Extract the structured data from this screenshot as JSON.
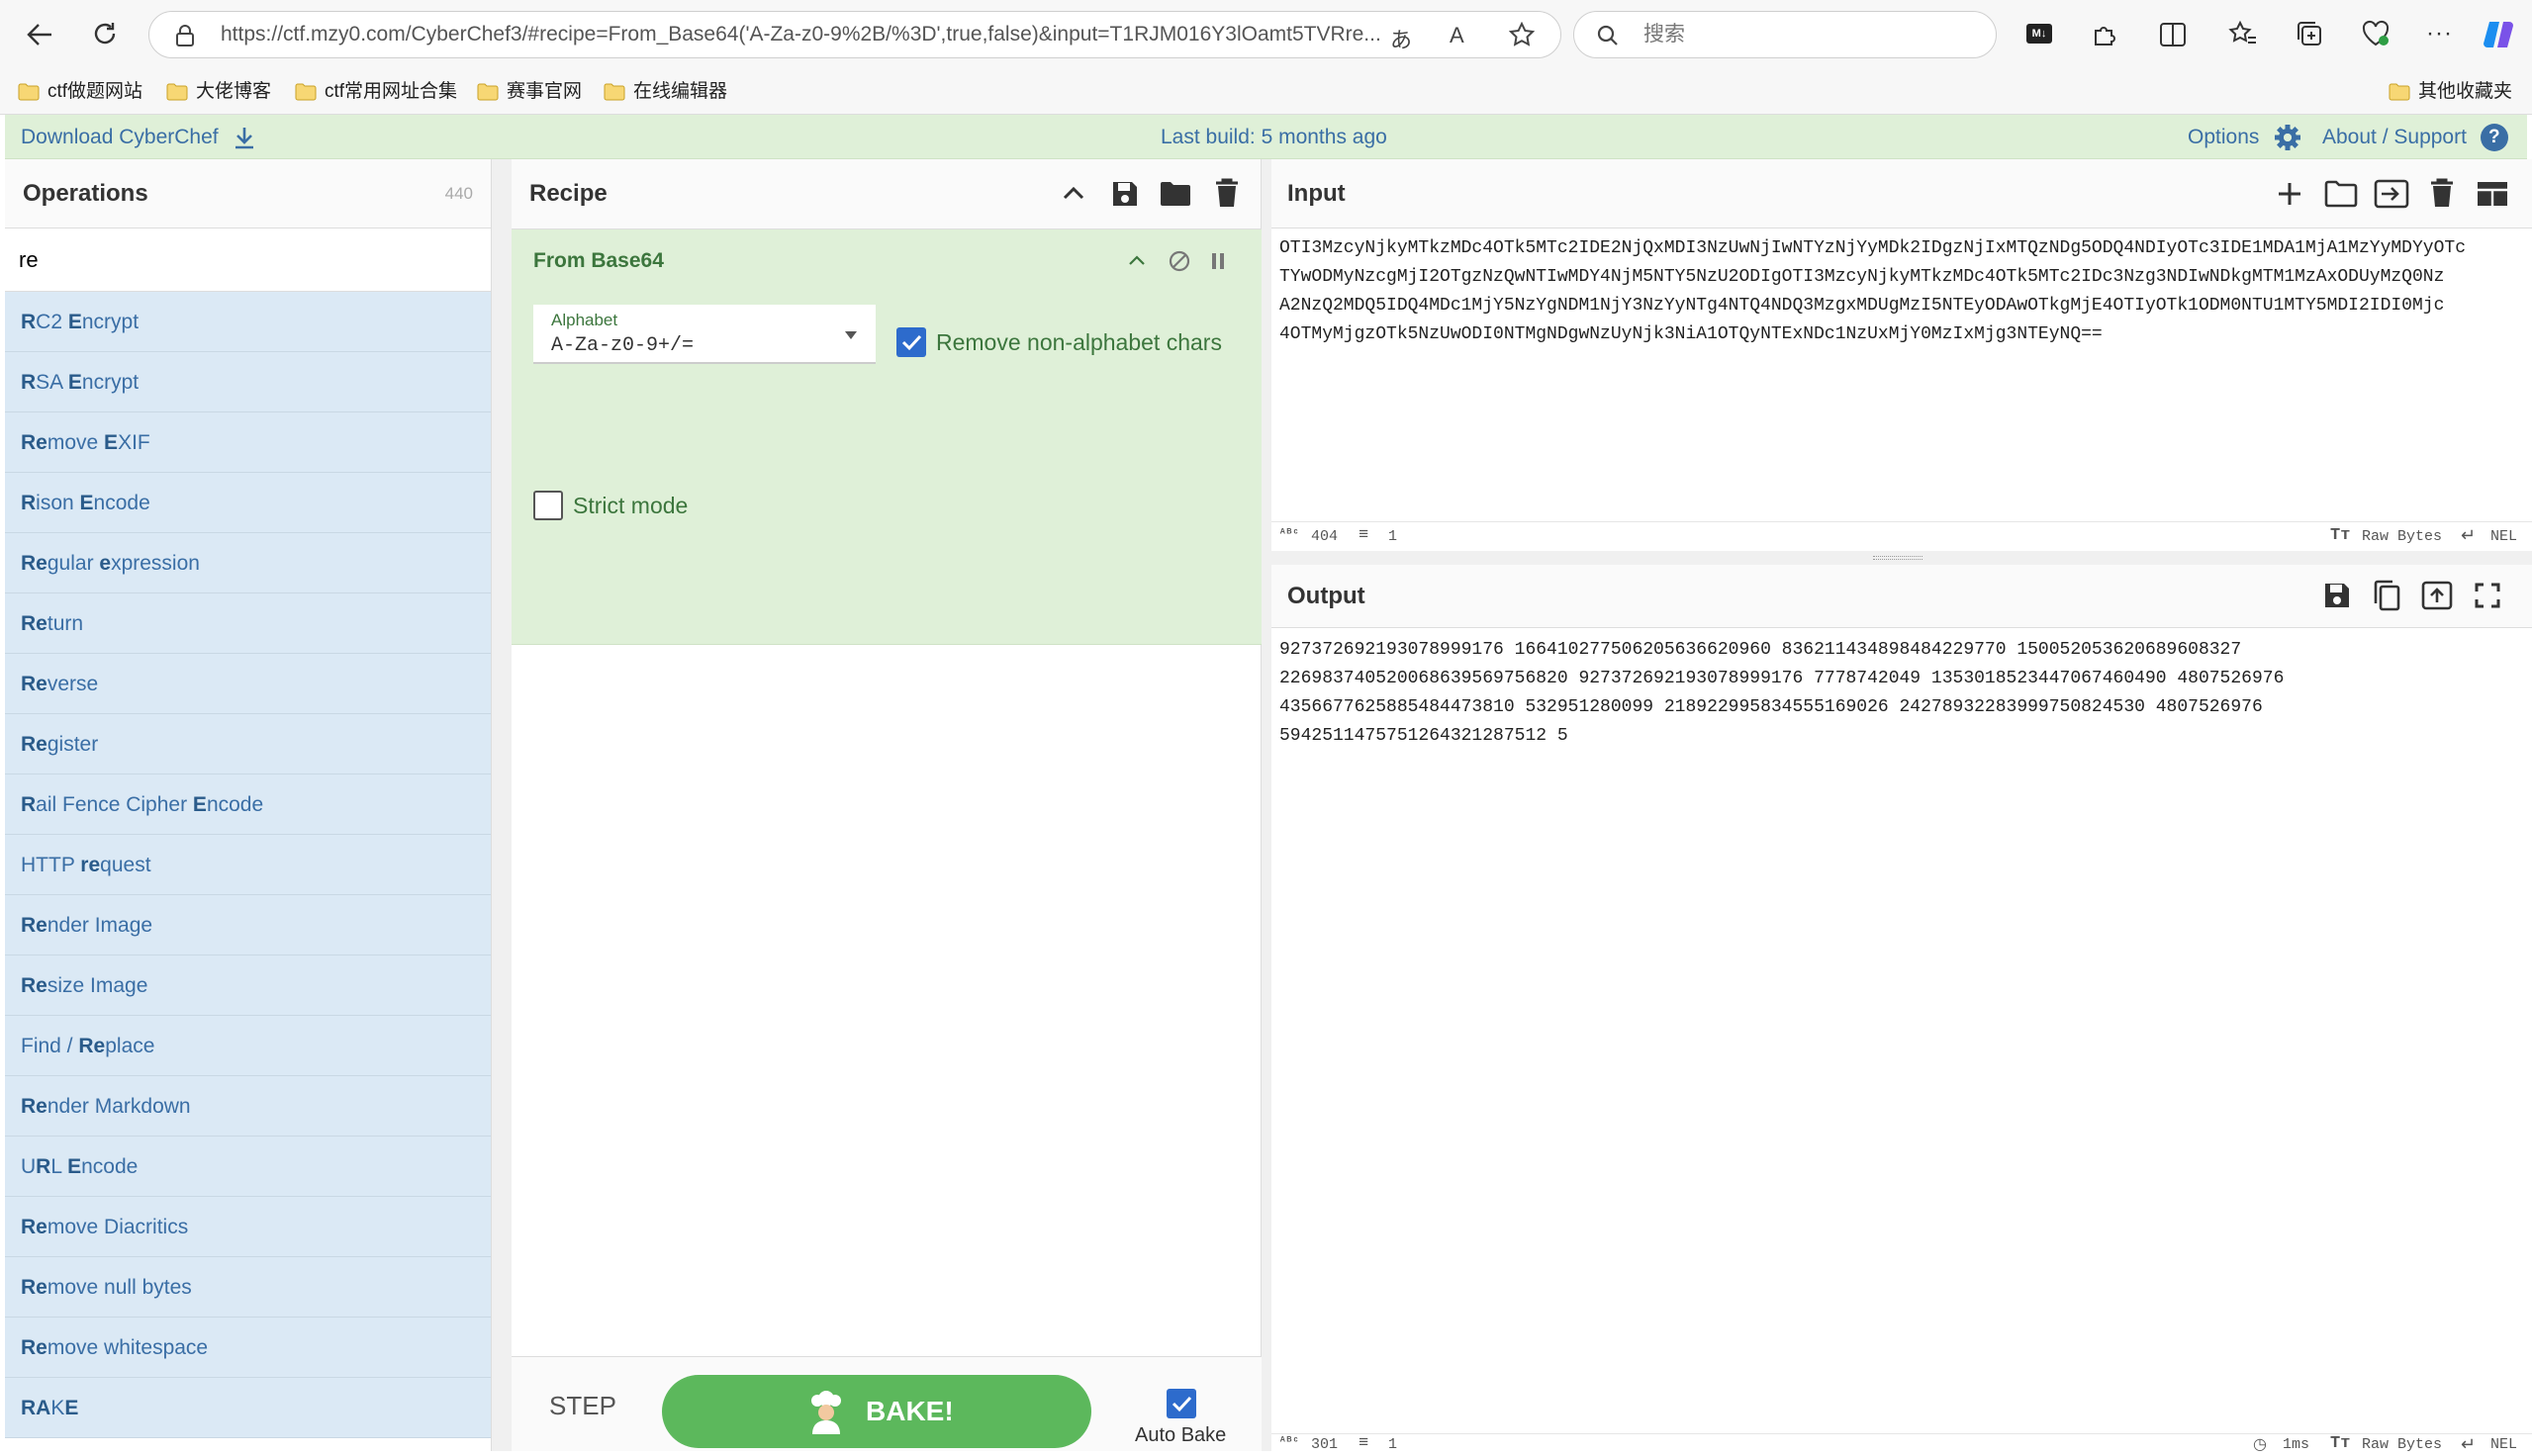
{
  "browser": {
    "url": "https://ctf.mzy0.com/CyberChef3/#recipe=From_Base64('A-Za-z0-9%2B/%3D',true,false)&input=T1RJM016Y3lOamt5TVRre...",
    "search_placeholder": "搜索",
    "bookmarks": [
      "ctf做题网站",
      "大佬博客",
      "ctf常用网址合集",
      "赛事官网",
      "在线编辑器"
    ],
    "other_bookmarks": "其他收藏夹"
  },
  "banner": {
    "download": "Download CyberChef",
    "last_build": "Last build: 5 months ago",
    "options": "Options",
    "about": "About / Support"
  },
  "operations": {
    "title": "Operations",
    "count": "440",
    "search_value": "re",
    "items": [
      {
        "b1": "R",
        "t1": "C2 ",
        "b2": "E",
        "t2": "ncrypt"
      },
      {
        "b1": "R",
        "t1": "SA ",
        "b2": "E",
        "t2": "ncrypt"
      },
      {
        "b1": "Re",
        "t1": "move ",
        "b2": "E",
        "t2": "XIF"
      },
      {
        "b1": "R",
        "t1": "ison ",
        "b2": "E",
        "t2": "ncode"
      },
      {
        "b1": "Re",
        "t1": "gular ",
        "b2": "e",
        "t2": "xpression"
      },
      {
        "b1": "Re",
        "t1": "turn",
        "b2": "",
        "t2": ""
      },
      {
        "b1": "Re",
        "t1": "verse",
        "b2": "",
        "t2": ""
      },
      {
        "b1": "Re",
        "t1": "gister",
        "b2": "",
        "t2": ""
      },
      {
        "b1": "R",
        "t1": "ail Fence Cipher ",
        "b2": "E",
        "t2": "ncode"
      },
      {
        "pre": "HTTP ",
        "b1": "re",
        "t1": "quest",
        "b2": "",
        "t2": ""
      },
      {
        "b1": "Re",
        "t1": "nder Image",
        "b2": "",
        "t2": ""
      },
      {
        "b1": "Re",
        "t1": "size Image",
        "b2": "",
        "t2": ""
      },
      {
        "pre": "Find / ",
        "b1": "Re",
        "t1": "place",
        "b2": "",
        "t2": ""
      },
      {
        "b1": "Re",
        "t1": "nder Markdown",
        "b2": "",
        "t2": ""
      },
      {
        "pre": "U",
        "b1": "R",
        "t1": "L ",
        "b2": "E",
        "t2": "ncode"
      },
      {
        "b1": "Re",
        "t1": "move Diacritics",
        "b2": "",
        "t2": ""
      },
      {
        "b1": "Re",
        "t1": "move null bytes",
        "b2": "",
        "t2": ""
      },
      {
        "b1": "Re",
        "t1": "move whitespace",
        "b2": "",
        "t2": ""
      },
      {
        "b1": "RA",
        "t1": "K",
        "b2": "E",
        "t2": ""
      }
    ]
  },
  "recipe": {
    "title": "Recipe",
    "op_name": "From Base64",
    "alphabet_label": "Alphabet",
    "alphabet_value": "A-Za-z0-9+/=",
    "remove_label": "Remove non-alphabet chars",
    "remove_checked": true,
    "strict_label": "Strict mode",
    "strict_checked": false,
    "step": "STEP",
    "bake": "BAKE!",
    "autobake": "Auto Bake",
    "autobake_checked": true
  },
  "input": {
    "title": "Input",
    "lines": [
      "OTI3MzcyNjkyMTkzMDc4OTk5MTc2IDE2NjQxMDI3NzUwNjIwNTYzNjYyMDk2IDgzNjIxMTQzNDg5ODQ4NDIyOTc3IDE1MDA1MjA1MzYyMDYyOTc",
      "TYwODMyNzcgMjI2OTgzNzQwNTIwMDY4NjM5NTY5NzU2ODIgOTI3MzcyNjkyMTkzMDc4OTk5MTc2IDc3Nzg3NDIwNDkgMTM1MzAxODUyMzQ0Nz",
      "A2NzQ2MDQ5IDQ4MDc1MjY5NzYgNDM1NjY3NzYyNTg4NTQ4NDQ3MzgxMDUgMzI5NTEyODAwOTkgMjE4OTIyOTk1ODM0NTU1MTY5MDI2IDI0Mjc",
      "4OTMyMjgzOTk5NzUwODI0NTMgNDgwNzUyNjk3NiA1OTQyNTExNDc1NzUxMjY0MzIxMjg3NTEyNQ=="
    ],
    "length": "404",
    "line_count": "1",
    "encoding": "Raw Bytes",
    "eol": "NEL"
  },
  "output": {
    "title": "Output",
    "lines": [
      "927372692193078999176 166410277506205636620960 836211434898484229770 150052053620689608327",
      "226983740520068639569756820 927372692193078999176 7778742049 1353018523447067460490 4807526976",
      "4356677625885484473810 532951280099 218922995834555169026 24278932283999750824530 4807526976",
      "5942511475751264321287512 5"
    ],
    "length": "301",
    "line_count": "1",
    "time": "1ms",
    "encoding": "Raw Bytes",
    "eol": "NEL"
  },
  "colors": {
    "accent_blue": "#3a6ea5",
    "recipe_green": "#dff0d8",
    "bake_green": "#5cb85c"
  }
}
